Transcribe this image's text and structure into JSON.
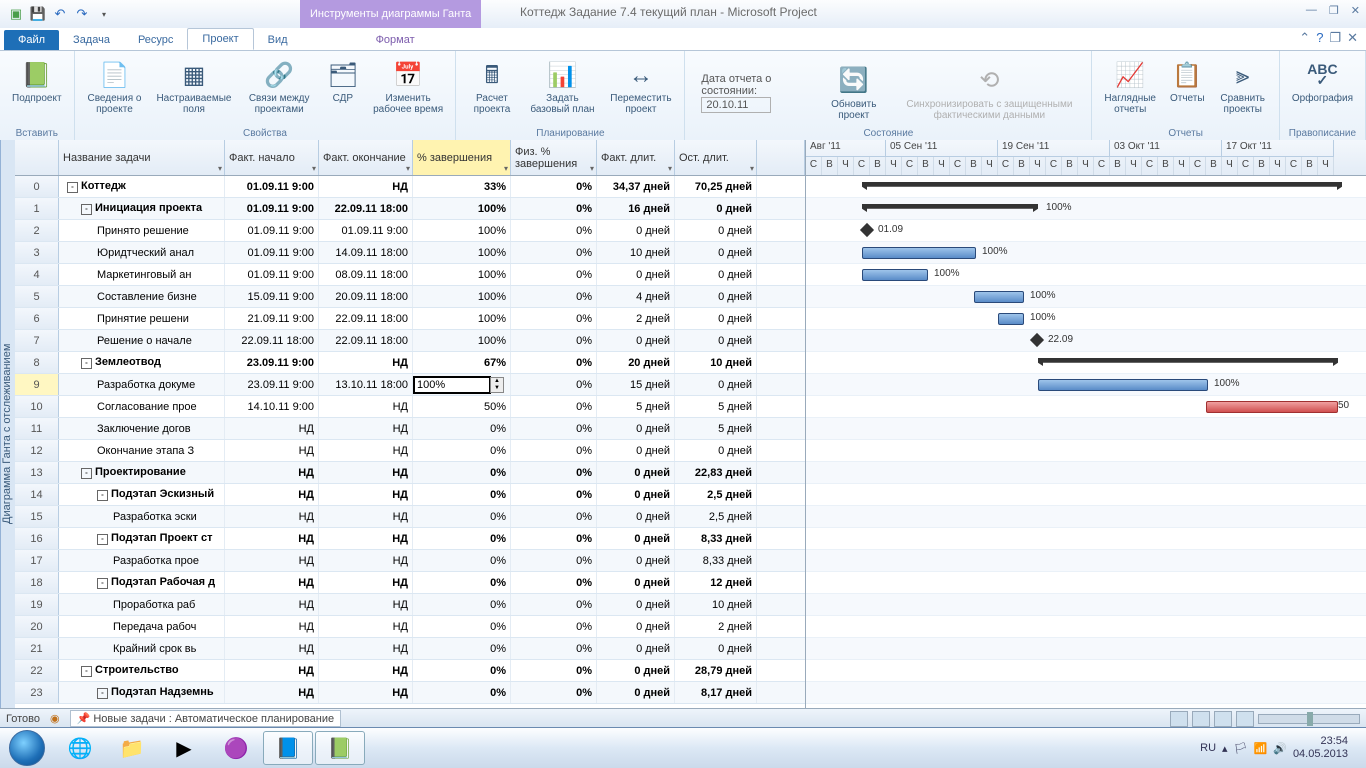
{
  "title": "Коттедж Задание 7.4 текущий план  -  Microsoft Project",
  "contextual": "Инструменты диаграммы Ганта",
  "tabs": {
    "file": "Файл",
    "task": "Задача",
    "resource": "Ресурс",
    "project": "Проект",
    "view": "Вид",
    "format": "Формат"
  },
  "ribbon": {
    "insert": {
      "subproject": "Подпроект",
      "label": "Вставить"
    },
    "props": {
      "info": "Сведения о проекте",
      "custom": "Настраиваемые поля",
      "links": "Связи между проектами",
      "wbs": "СДР",
      "worktime": "Изменить рабочее время",
      "label": "Свойства"
    },
    "plan": {
      "calc": "Расчет проекта",
      "baseline": "Задать базовый план",
      "move": "Переместить проект",
      "label": "Планирование"
    },
    "status": {
      "datelabel": "Дата отчета о состоянии:",
      "dateval": "20.10.11",
      "update": "Обновить проект",
      "sync": "Синхронизировать с защищенными фактическими данными",
      "label": "Состояние"
    },
    "reports": {
      "visual": "Наглядные отчеты",
      "reports": "Отчеты",
      "compare": "Сравнить проекты",
      "label": "Отчеты"
    },
    "spell": {
      "spell": "Орфография",
      "label": "Правописание"
    }
  },
  "cols": {
    "name": "Название задачи",
    "fstart": "Факт. начало",
    "fend": "Факт. окончание",
    "pct": "% завершения",
    "phys": "Физ. % завершения",
    "fdur": "Факт. длит.",
    "rdur": "Ост. длит."
  },
  "rows": [
    {
      "id": 0,
      "lvl": 0,
      "exp": "-",
      "name": "Коттедж",
      "fs": "01.09.11 9:00",
      "fe": "НД",
      "pct": "33%",
      "phys": "0%",
      "fd": "34,37 дней",
      "rd": "70,25 дней",
      "bold": true
    },
    {
      "id": 1,
      "lvl": 1,
      "exp": "-",
      "name": "Инициация проекта",
      "fs": "01.09.11 9:00",
      "fe": "22.09.11 18:00",
      "pct": "100%",
      "phys": "0%",
      "fd": "16 дней",
      "rd": "0 дней",
      "bold": true
    },
    {
      "id": 2,
      "lvl": 2,
      "name": "Принято решение",
      "fs": "01.09.11 9:00",
      "fe": "01.09.11 9:00",
      "pct": "100%",
      "phys": "0%",
      "fd": "0 дней",
      "rd": "0 дней"
    },
    {
      "id": 3,
      "lvl": 2,
      "name": "Юридтческий анал",
      "fs": "01.09.11 9:00",
      "fe": "14.09.11 18:00",
      "pct": "100%",
      "phys": "0%",
      "fd": "10 дней",
      "rd": "0 дней"
    },
    {
      "id": 4,
      "lvl": 2,
      "name": "Маркетинговый ан",
      "fs": "01.09.11 9:00",
      "fe": "08.09.11 18:00",
      "pct": "100%",
      "phys": "0%",
      "fd": "0 дней",
      "rd": "0 дней"
    },
    {
      "id": 5,
      "lvl": 2,
      "name": "Составление бизне",
      "fs": "15.09.11 9:00",
      "fe": "20.09.11 18:00",
      "pct": "100%",
      "phys": "0%",
      "fd": "4 дней",
      "rd": "0 дней"
    },
    {
      "id": 6,
      "lvl": 2,
      "name": "Принятие решени",
      "fs": "21.09.11 9:00",
      "fe": "22.09.11 18:00",
      "pct": "100%",
      "phys": "0%",
      "fd": "2 дней",
      "rd": "0 дней"
    },
    {
      "id": 7,
      "lvl": 2,
      "name": "Решение о начале",
      "fs": "22.09.11 18:00",
      "fe": "22.09.11 18:00",
      "pct": "100%",
      "phys": "0%",
      "fd": "0 дней",
      "rd": "0 дней"
    },
    {
      "id": 8,
      "lvl": 1,
      "exp": "-",
      "name": "Землеотвод",
      "fs": "23.09.11 9:00",
      "fe": "НД",
      "pct": "67%",
      "phys": "0%",
      "fd": "20 дней",
      "rd": "10 дней",
      "bold": true
    },
    {
      "id": 9,
      "lvl": 2,
      "name": "Разработка докуме",
      "fs": "23.09.11 9:00",
      "fe": "13.10.11 18:00",
      "pct": "",
      "phys": "0%",
      "fd": "15 дней",
      "rd": "0 дней",
      "sel": true,
      "edit": "100%"
    },
    {
      "id": 10,
      "lvl": 2,
      "name": "Согласование прое",
      "fs": "14.10.11 9:00",
      "fe": "НД",
      "pct": "50%",
      "phys": "0%",
      "fd": "5 дней",
      "rd": "5 дней"
    },
    {
      "id": 11,
      "lvl": 2,
      "name": "Заключение догов",
      "fs": "НД",
      "fe": "НД",
      "pct": "0%",
      "phys": "0%",
      "fd": "0 дней",
      "rd": "5 дней"
    },
    {
      "id": 12,
      "lvl": 2,
      "name": "Окончание этапа З",
      "fs": "НД",
      "fe": "НД",
      "pct": "0%",
      "phys": "0%",
      "fd": "0 дней",
      "rd": "0 дней"
    },
    {
      "id": 13,
      "lvl": 1,
      "exp": "-",
      "name": "Проектирование",
      "fs": "НД",
      "fe": "НД",
      "pct": "0%",
      "phys": "0%",
      "fd": "0 дней",
      "rd": "22,83 дней",
      "bold": true
    },
    {
      "id": 14,
      "lvl": 2,
      "exp": "-",
      "name": "Подэтап Эскизный",
      "fs": "НД",
      "fe": "НД",
      "pct": "0%",
      "phys": "0%",
      "fd": "0 дней",
      "rd": "2,5 дней",
      "bold": true
    },
    {
      "id": 15,
      "lvl": 3,
      "name": "Разработка эски",
      "fs": "НД",
      "fe": "НД",
      "pct": "0%",
      "phys": "0%",
      "fd": "0 дней",
      "rd": "2,5 дней"
    },
    {
      "id": 16,
      "lvl": 2,
      "exp": "-",
      "name": "Подэтап Проект ст",
      "fs": "НД",
      "fe": "НД",
      "pct": "0%",
      "phys": "0%",
      "fd": "0 дней",
      "rd": "8,33 дней",
      "bold": true
    },
    {
      "id": 17,
      "lvl": 3,
      "name": "Разработка прое",
      "fs": "НД",
      "fe": "НД",
      "pct": "0%",
      "phys": "0%",
      "fd": "0 дней",
      "rd": "8,33 дней"
    },
    {
      "id": 18,
      "lvl": 2,
      "exp": "-",
      "name": "Подэтап Рабочая д",
      "fs": "НД",
      "fe": "НД",
      "pct": "0%",
      "phys": "0%",
      "fd": "0 дней",
      "rd": "12 дней",
      "bold": true
    },
    {
      "id": 19,
      "lvl": 3,
      "name": "Проработка раб",
      "fs": "НД",
      "fe": "НД",
      "pct": "0%",
      "phys": "0%",
      "fd": "0 дней",
      "rd": "10 дней"
    },
    {
      "id": 20,
      "lvl": 3,
      "name": "Передача рабоч",
      "fs": "НД",
      "fe": "НД",
      "pct": "0%",
      "phys": "0%",
      "fd": "0 дней",
      "rd": "2 дней"
    },
    {
      "id": 21,
      "lvl": 3,
      "name": "Крайний срок вь",
      "fs": "НД",
      "fe": "НД",
      "pct": "0%",
      "phys": "0%",
      "fd": "0 дней",
      "rd": "0 дней"
    },
    {
      "id": 22,
      "lvl": 1,
      "exp": "-",
      "name": "Строительство",
      "fs": "НД",
      "fe": "НД",
      "pct": "0%",
      "phys": "0%",
      "fd": "0 дней",
      "rd": "28,79 дней",
      "bold": true
    },
    {
      "id": 23,
      "lvl": 2,
      "exp": "-",
      "name": "Подэтап Надземнь",
      "fs": "НД",
      "fe": "НД",
      "pct": "0%",
      "phys": "0%",
      "fd": "0 дней",
      "rd": "8,17 дней",
      "bold": true
    }
  ],
  "timeline": {
    "months": [
      {
        "label": "Авг '11",
        "w": 80
      },
      {
        "label": "05 Сен '11",
        "w": 112
      },
      {
        "label": "19 Сен '11",
        "w": 112
      },
      {
        "label": "03 Окт '11",
        "w": 112
      },
      {
        "label": "17 Окт '11",
        "w": 112
      }
    ],
    "days": [
      "С",
      "В",
      "Ч",
      "С",
      "В",
      "Ч",
      "С",
      "В",
      "Ч",
      "С",
      "В",
      "Ч",
      "С",
      "В",
      "Ч",
      "С",
      "В",
      "Ч",
      "С",
      "В",
      "Ч",
      "С",
      "В",
      "Ч",
      "С",
      "В",
      "Ч",
      "С",
      "В",
      "Ч",
      "С",
      "В",
      "Ч"
    ]
  },
  "glabels": {
    "r1": "100%",
    "r2": "01.09",
    "r3": "100%",
    "r4": "100%",
    "r5": "100%",
    "r6": "100%",
    "r7": "22.09",
    "r9": "100%",
    "r10": "50"
  },
  "leftpane": "Диаграмма Ганта с отслеживанием",
  "statusbar": {
    "ready": "Готово",
    "newtask": "Новые задачи : Автоматическое планирование"
  },
  "taskbar": {
    "lang": "RU",
    "time": "23:54",
    "date": "04.05.2013"
  }
}
